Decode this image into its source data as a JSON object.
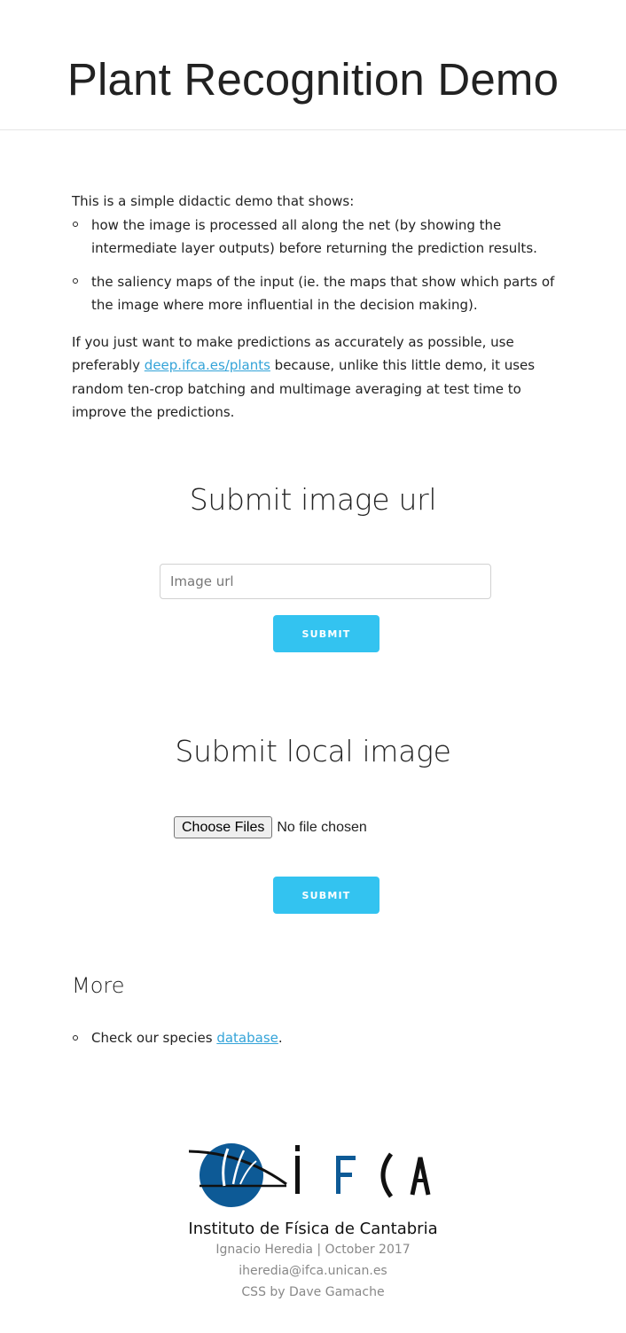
{
  "header": {
    "title": "Plant Recognition Demo"
  },
  "intro": {
    "lead": "This is a simple didactic demo that shows:",
    "bullets": [
      "how the image is processed all along the net (by showing the intermediate layer outputs) before returning the prediction results.",
      "the saliency maps of the input (ie. the maps that show which parts of the image where more influential in the decision making)."
    ],
    "para_before_link": "If you just want to make predictions as accurately as possible, use preferably ",
    "link_text": "deep.ifca.es/plants",
    "para_after_link": " because, unlike this little demo, it uses random ten-crop batching and multimage averaging at test time to improve the predictions."
  },
  "url_section": {
    "title": "Submit image url",
    "input_placeholder": "Image url",
    "input_value": "",
    "submit_label": "SUBMIT"
  },
  "local_section": {
    "title": "Submit local image",
    "choose_label": "Choose Files",
    "file_status": "No file chosen",
    "submit_label": "SUBMIT"
  },
  "more": {
    "title": "More",
    "item_prefix": "Check our species ",
    "item_link": "database",
    "item_suffix": "."
  },
  "footer": {
    "logo_text": "IFCA",
    "institute": "Instituto de Física de Cantabria",
    "credit": "Ignacio Heredia | October 2017",
    "email": "iheredia@ifca.unican.es",
    "css_credit": "CSS by Dave Gamache"
  },
  "colors": {
    "accent": "#33c3f0",
    "link": "#33a3d8",
    "logo_blue": "#0d5a96"
  }
}
